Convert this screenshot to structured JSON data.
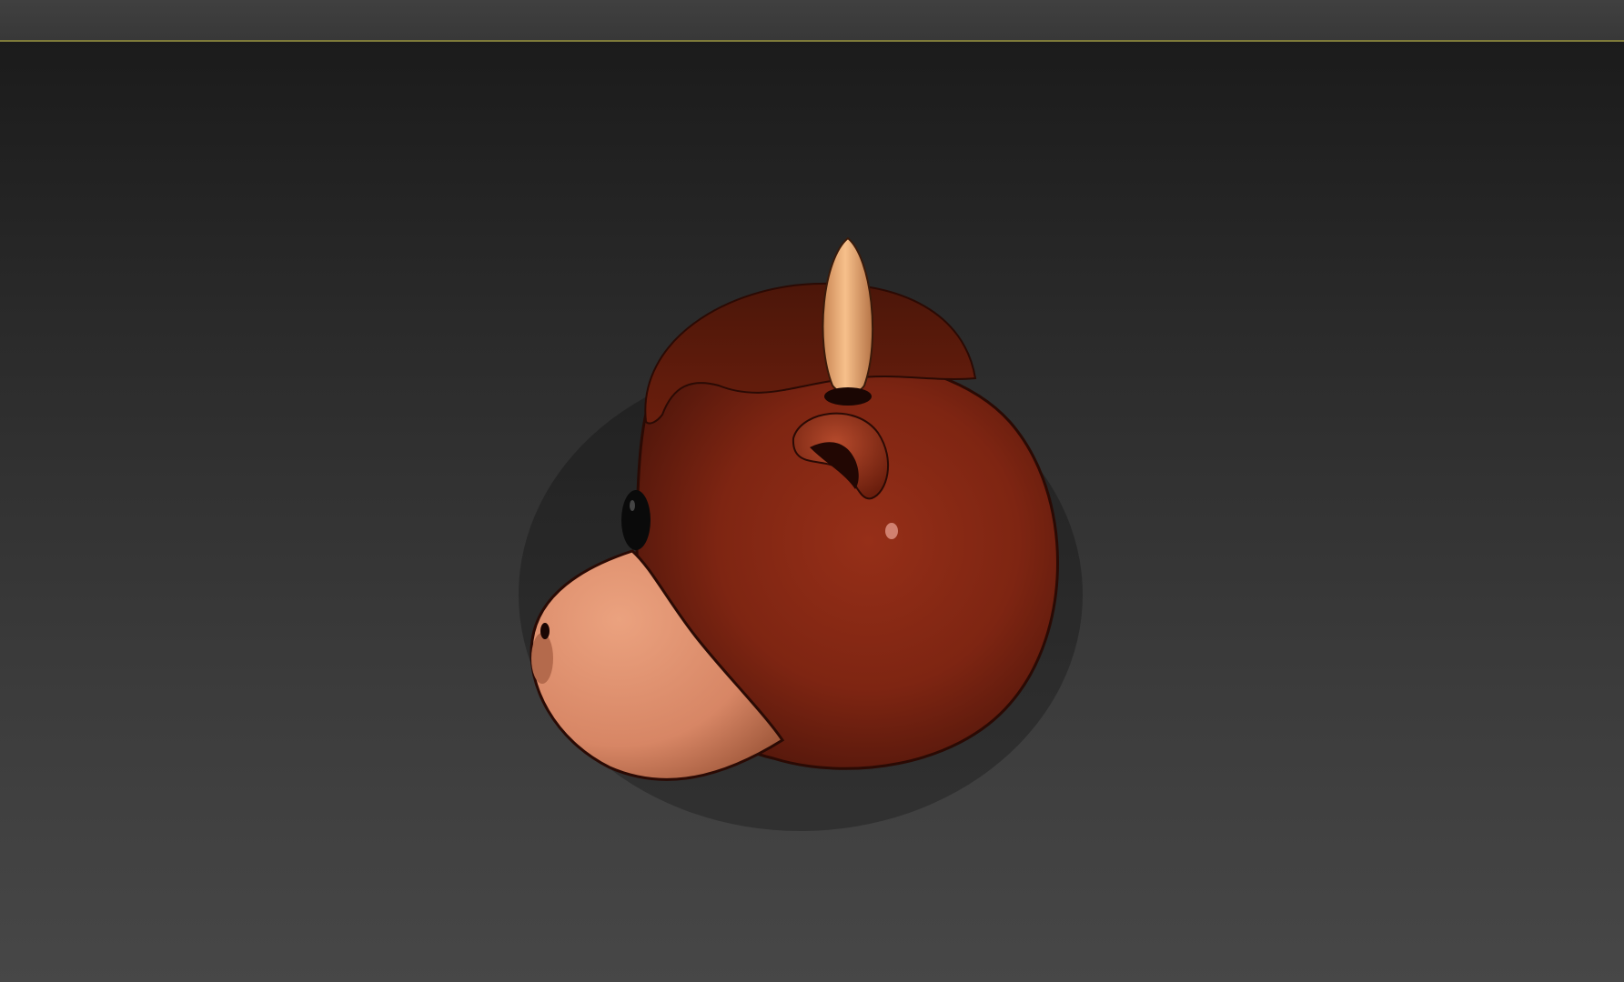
{
  "app": {
    "view": "3D viewport",
    "active_view_highlight_color": "#7e7a3a"
  },
  "viewport": {
    "background_top_color": "#1b1b1b",
    "background_bottom_color": "#474747",
    "object": {
      "type": "cartoon-bull-head-model",
      "head_color": "#8a2a15",
      "hair_color": "#5a1a0c",
      "muzzle_color": "#e49a78",
      "horn_color": "#f2b27a",
      "eye_color": "#0a0a0a"
    }
  }
}
